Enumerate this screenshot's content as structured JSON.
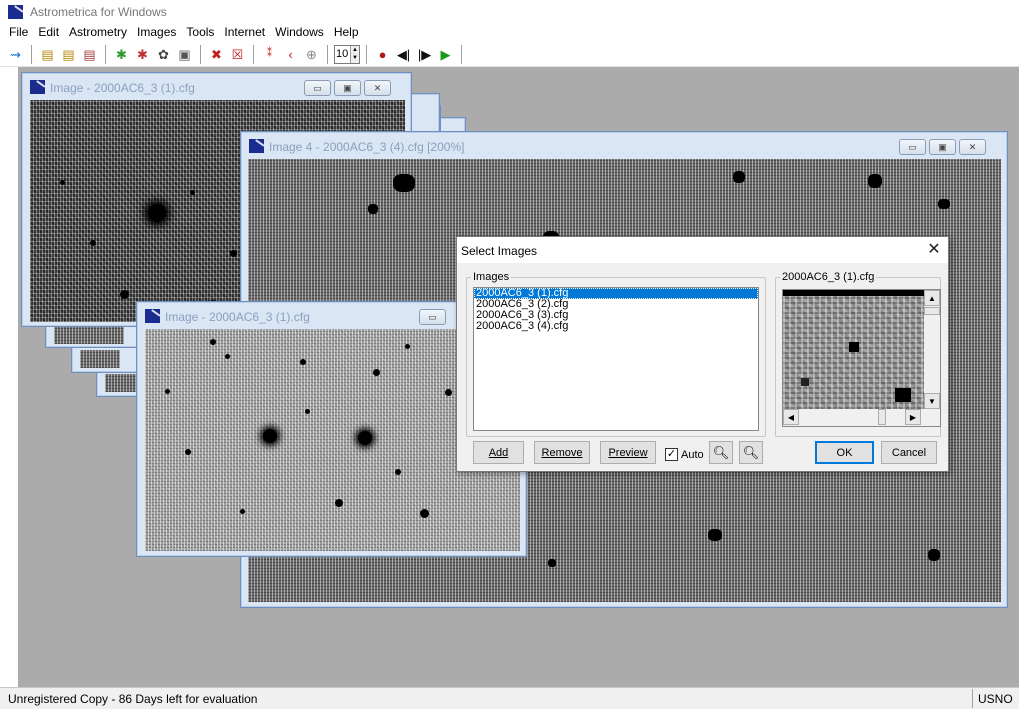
{
  "app": {
    "title": "Astrometrica for Windows",
    "icon": "astrometrica-app-icon"
  },
  "menu": [
    "File",
    "Edit",
    "Astrometry",
    "Images",
    "Tools",
    "Internet",
    "Windows",
    "Help"
  ],
  "toolbar": {
    "zoom_value": "10",
    "icons": [
      "link-icon",
      "open-images-icon",
      "open-images-2-icon",
      "open-images-3-icon",
      "settings-green-icon",
      "settings-red-icon",
      "dark-frame-icon",
      "blink-window-icon",
      "no-stars-icon",
      "no-stars-2-icon",
      "track-and-stack-icon",
      "reference-icon",
      "record-icon",
      "step-back-icon",
      "step-forward-icon",
      "play-icon"
    ]
  },
  "windows": {
    "back1_title": "Image - 2000AC6_3 (1).cfg",
    "front_title": "Image - 2000AC6_3 (1).cfg",
    "img4_title": "Image 4 - 2000AC6_3 (4).cfg [200%]"
  },
  "dialog": {
    "title": "Select Images",
    "images_group_label": "Images",
    "files": [
      "2000AC6_3 (1).cfg",
      "2000AC6_3 (2).cfg",
      "2000AC6_3 (3).cfg",
      "2000AC6_3 (4).cfg"
    ],
    "preview_label": "2000AC6_3 (1).cfg",
    "buttons": {
      "add": "Add",
      "remove": "Remove",
      "preview": "Preview",
      "ok": "OK",
      "cancel": "Cancel"
    },
    "auto_label": "Auto",
    "auto_checked": true
  },
  "status": {
    "text": "Unregistered Copy - 86 Days left for evaluation",
    "right": "USNO"
  }
}
